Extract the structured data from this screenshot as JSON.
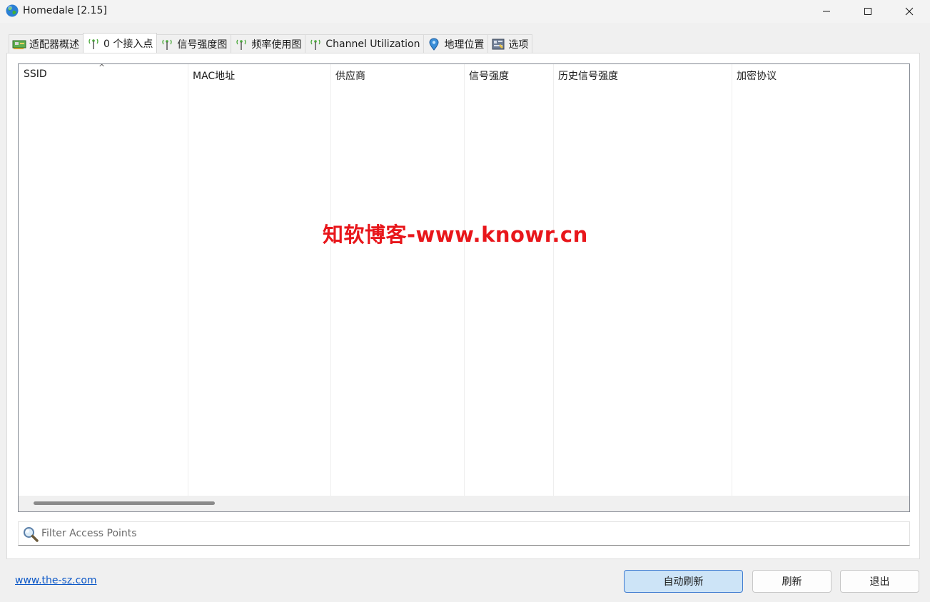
{
  "window": {
    "title": "Homedale [2.15]"
  },
  "tabs": [
    {
      "label": "适配器概述",
      "icon": "adapter-card-icon"
    },
    {
      "label": "0 个接入点",
      "icon": "antenna-icon"
    },
    {
      "label": "信号强度图",
      "icon": "antenna-icon"
    },
    {
      "label": "频率使用图",
      "icon": "antenna-icon"
    },
    {
      "label": "Channel Utilization",
      "icon": "antenna-icon"
    },
    {
      "label": "地理位置",
      "icon": "location-pin-icon"
    },
    {
      "label": "选项",
      "icon": "options-icon"
    }
  ],
  "active_tab": 1,
  "table": {
    "columns": [
      "SSID",
      "MAC地址",
      "供应商",
      "信号强度",
      "历史信号强度",
      "加密协议"
    ],
    "sort_indicator": "^",
    "rows": []
  },
  "watermark": "知软博客-www.knowr.cn",
  "filter": {
    "placeholder": "Filter Access Points",
    "value": ""
  },
  "footer": {
    "link": "www.the-sz.com",
    "auto_refresh": "自动刷新",
    "refresh": "刷新",
    "exit": "退出"
  },
  "colors": {
    "accent": "#3d7ad0",
    "watermark": "#e8161b",
    "link": "#0b57c7"
  }
}
